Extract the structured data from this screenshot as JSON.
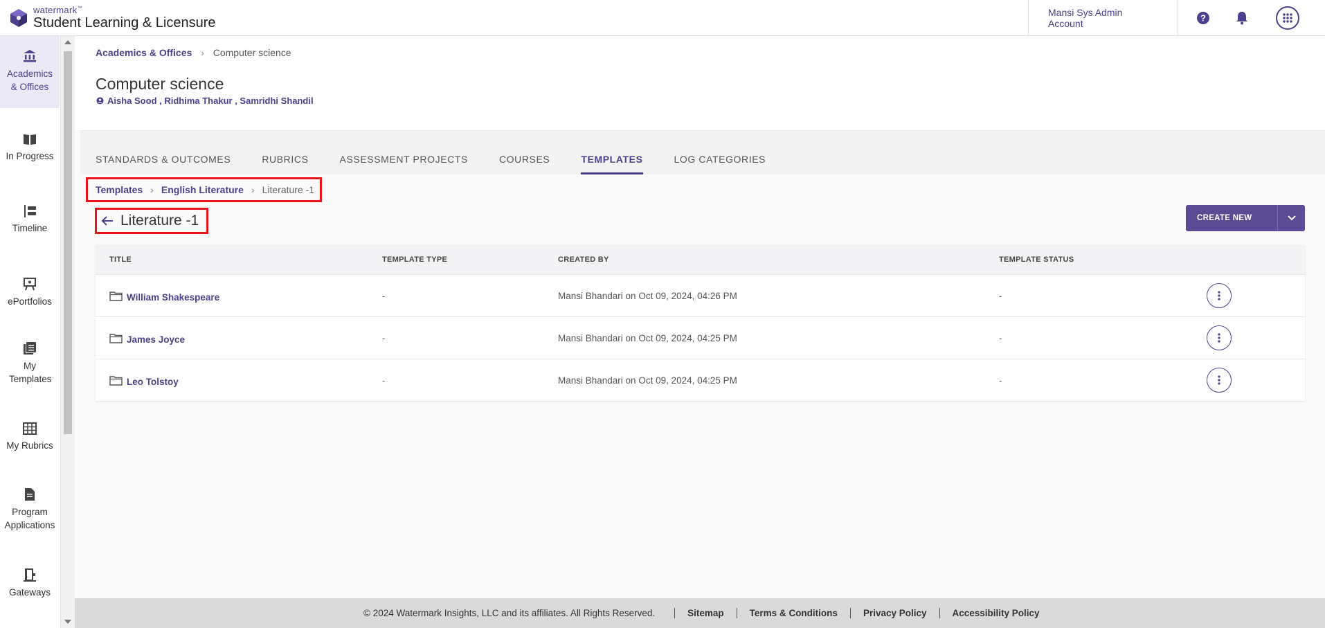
{
  "header": {
    "brand_small": "watermark",
    "brand_tm": "™",
    "brand_main": "Student Learning & Licensure",
    "account": "Mansi Sys Admin Account",
    "icons": [
      "help-icon",
      "bell-icon",
      "apps-grid-icon"
    ]
  },
  "sidebar": {
    "items": [
      {
        "label": "Academics & Offices",
        "icon": "institution-icon"
      },
      {
        "label": "In Progress",
        "icon": "book-icon"
      },
      {
        "label": "Timeline",
        "icon": "timeline-icon"
      },
      {
        "label": "ePortfolios",
        "icon": "easel-icon"
      },
      {
        "label": "My Templates",
        "icon": "templates-icon"
      },
      {
        "label": "My Rubrics",
        "icon": "grid-icon"
      },
      {
        "label": "Program Applications",
        "icon": "document-icon"
      },
      {
        "label": "Gateways",
        "icon": "door-icon"
      }
    ]
  },
  "page": {
    "breadcrumb": {
      "parent": "Academics & Offices",
      "separator": "›",
      "current": "Computer science"
    },
    "title": "Computer science",
    "members": "Aisha Sood , Ridhima Thakur , Samridhi Shandil"
  },
  "tabs": [
    {
      "label": "STANDARDS & OUTCOMES"
    },
    {
      "label": "RUBRICS"
    },
    {
      "label": "ASSESSMENT PROJECTS"
    },
    {
      "label": "COURSES"
    },
    {
      "label": "TEMPLATES"
    },
    {
      "label": "LOG CATEGORIES"
    }
  ],
  "templates": {
    "breadcrumb": {
      "root": "Templates",
      "sep": "›",
      "mid": "English Literature",
      "current": "Literature -1"
    },
    "title": "Literature -1",
    "create_button": "CREATE NEW",
    "columns": [
      "TITLE",
      "TEMPLATE TYPE",
      "CREATED BY",
      "TEMPLATE STATUS"
    ],
    "rows": [
      {
        "title": "William Shakespeare",
        "type": "-",
        "created_by": "Mansi Bhandari on Oct 09, 2024, 04:26 PM",
        "status": "-"
      },
      {
        "title": "James Joyce",
        "type": "-",
        "created_by": "Mansi Bhandari on Oct 09, 2024, 04:25 PM",
        "status": "-"
      },
      {
        "title": "Leo Tolstoy",
        "type": "-",
        "created_by": "Mansi Bhandari on Oct 09, 2024, 04:25 PM",
        "status": "-"
      }
    ]
  },
  "footer": {
    "copyright": "© 2024 Watermark Insights, LLC and its affiliates. All Rights Reserved.",
    "links": [
      "Sitemap",
      "Terms & Conditions",
      "Privacy Policy",
      "Accessibility Policy"
    ]
  },
  "colors": {
    "accent": "#4f3f8f",
    "highlight": "#e8141c",
    "button": "#5a4b94"
  }
}
